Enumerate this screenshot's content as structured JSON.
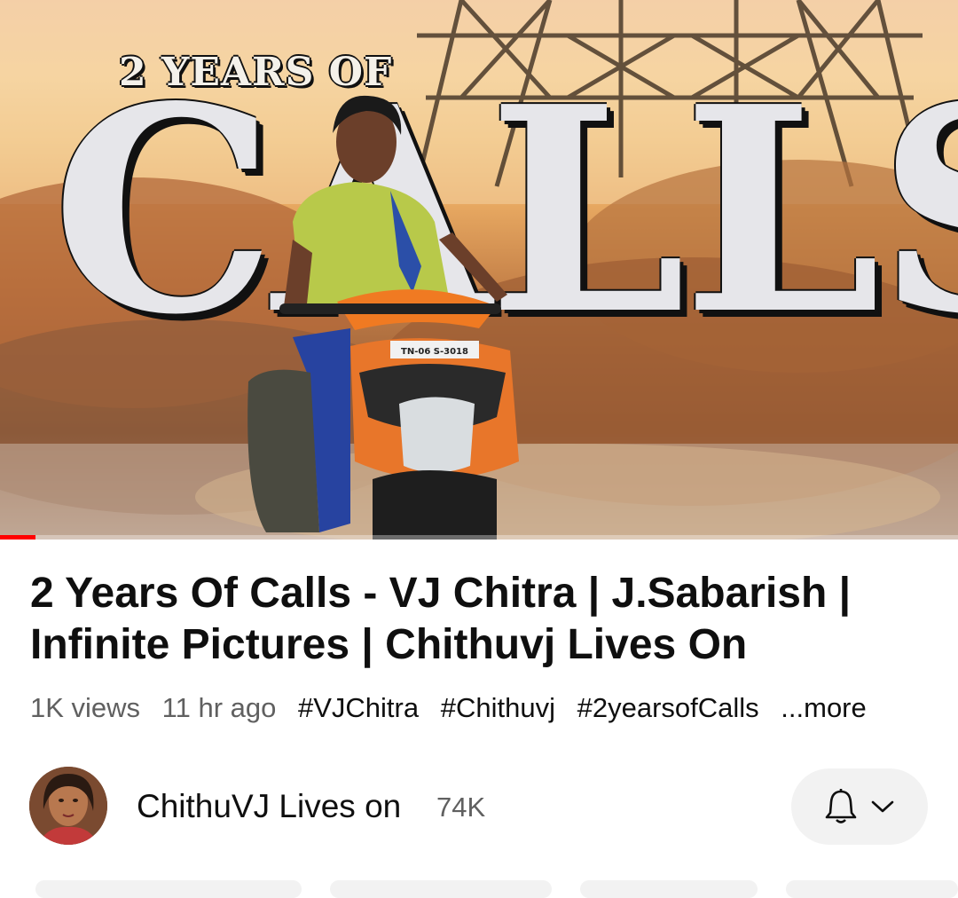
{
  "thumbnail": {
    "kicker_text": "2 YEARS OF",
    "big_text": "CALLS",
    "plate_text": "TN-06 S-3018",
    "progress_fraction": 0.037,
    "progress_color": "#ff0000"
  },
  "video": {
    "title": "2 Years Of Calls - VJ Chitra | J.Sabarish | Infinite Pictures | Chithuvj Lives On",
    "views": "1K views",
    "age": "11 hr ago",
    "hashtags": [
      "#VJChitra",
      "#Chithuvj",
      "#2yearsofCalls"
    ],
    "more_label": "...more"
  },
  "channel": {
    "name": "ChithuVJ Lives on",
    "subscribers": "74K",
    "avatar_icon": "channel-avatar",
    "bell_icon": "bell-icon",
    "chevron_icon": "chevron-down-icon"
  }
}
